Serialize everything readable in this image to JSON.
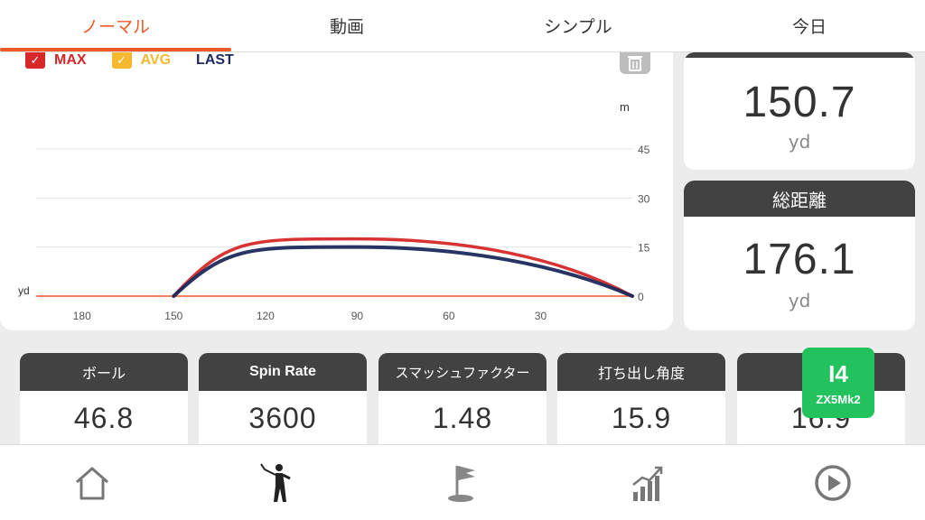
{
  "tabs": [
    {
      "label": "ノーマル",
      "active": true
    },
    {
      "label": "動画",
      "active": false
    },
    {
      "label": "シンプル",
      "active": false
    },
    {
      "label": "今日",
      "active": false
    }
  ],
  "legend": {
    "max": {
      "label": "MAX",
      "color": "#d62828"
    },
    "avg": {
      "label": "AVG",
      "color": "#f5b82e"
    },
    "last": {
      "label": "LAST",
      "color": "#1c2a5c"
    }
  },
  "chart_data": {
    "type": "line",
    "x_unit": "yd",
    "y_unit": "m",
    "x_ticks": [
      180,
      150,
      120,
      90,
      60,
      30
    ],
    "y_ticks": [
      0,
      15,
      30,
      45
    ],
    "xlim": [
      0,
      195
    ],
    "ylim": [
      0,
      45
    ],
    "series": [
      {
        "color": "#d62828",
        "start": 150,
        "end": 0,
        "peak_x": 90,
        "peak_y": 17.5
      },
      {
        "color": "#1c2a5c",
        "start": 150,
        "end": 0,
        "peak_x": 90,
        "peak_y": 15
      }
    ]
  },
  "right_cards": {
    "carry": {
      "value": "150.7",
      "unit": "yd"
    },
    "total": {
      "label": "総距離",
      "value": "176.1",
      "unit": "yd"
    }
  },
  "metrics": [
    {
      "label": "ボール",
      "value": "46.8"
    },
    {
      "label": "Spin Rate",
      "value": "3600"
    },
    {
      "label": "スマッシュファクター",
      "value": "1.48"
    },
    {
      "label": "打ち出し角度",
      "value": "15.9"
    },
    {
      "label": "",
      "value": "16.9"
    }
  ],
  "club": {
    "number": "I4",
    "model": "ZX5Mk2",
    "color": "#22c35e"
  },
  "nav": [
    "home-icon",
    "golfer-swing-icon",
    "golf-flag-icon",
    "stats-chart-icon",
    "play-circle-icon"
  ],
  "colors": {
    "accent": "#f05a28",
    "header_dark": "#424242"
  }
}
